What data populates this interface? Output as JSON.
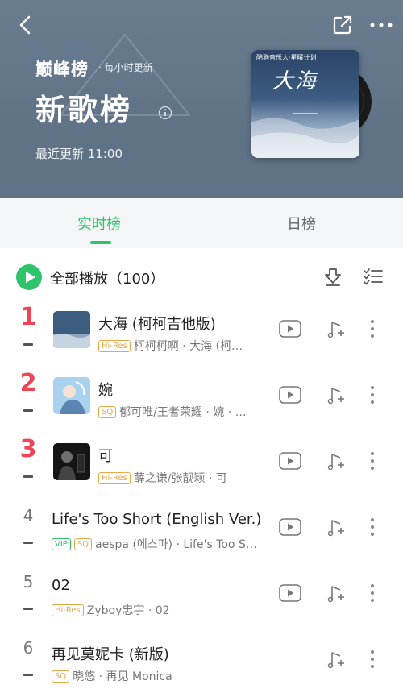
{
  "header": {
    "brand": "巅峰榜",
    "brand_sub": "· 每小时更新",
    "title": "新歌榜",
    "updated": "最近更新 11:00",
    "album": {
      "top_text": "酷狗音乐人·星曜计划",
      "title": "大海",
      "bg_color": "#2e4a6a"
    }
  },
  "tabs": [
    {
      "label": "实时榜",
      "active": true
    },
    {
      "label": "日榜",
      "active": false
    }
  ],
  "controls": {
    "play_all": "全部播放（100）"
  },
  "songs": [
    {
      "rank": "1",
      "title": "大海 (柯柯吉他版)",
      "badges": [
        "Hi-Res"
      ],
      "meta": "柯柯柯啊 · 大海 (柯…",
      "has_cover": true,
      "has_mv": true,
      "cover_color": "#3c5d80"
    },
    {
      "rank": "2",
      "title": "婉",
      "badges": [
        "SQ"
      ],
      "meta": "郁可唯/王者荣耀 · 婉 · …",
      "has_cover": true,
      "has_mv": true,
      "cover_color": "#7fb7dc"
    },
    {
      "rank": "3",
      "title": "可",
      "badges": [
        "Hi-Res"
      ],
      "meta": "薛之谦/张靓颖 · 可",
      "has_cover": true,
      "has_mv": true,
      "cover_color": "#1c1c1c"
    },
    {
      "rank": "4",
      "title": "Life's Too Short (English Ver.)",
      "badges": [
        "VIP",
        "SQ"
      ],
      "meta": "aespa (에스파) · Life's Too S…",
      "has_cover": false,
      "has_mv": true
    },
    {
      "rank": "5",
      "title": "02",
      "badges": [
        "Hi-Res"
      ],
      "meta": "Zyboy忠宇 · 02",
      "has_cover": false,
      "has_mv": true
    },
    {
      "rank": "6",
      "title": "再见莫妮卡 (新版)",
      "badges": [
        "SQ"
      ],
      "meta": "晓悠 · 再见 Monica",
      "has_cover": false,
      "has_mv": false
    }
  ],
  "colors": {
    "accent": "#2fc36b",
    "rank_top": "#ee4455",
    "header_bg": "#637589"
  }
}
